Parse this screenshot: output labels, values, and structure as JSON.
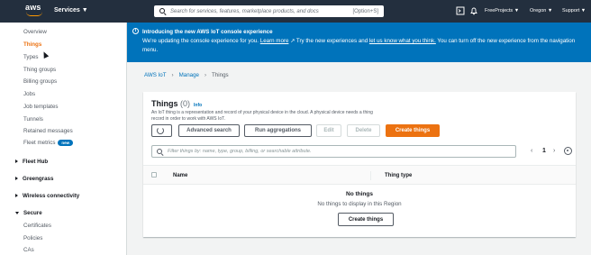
{
  "topnav": {
    "logo_text": "aws",
    "services_label": "Services ▼",
    "search_placeholder": "Search for services, features, marketplace products, and docs",
    "search_shortcut": "[Option+S]",
    "account": "FreeProjects ▼",
    "region": "Oregon ▼",
    "support": "Support ▼"
  },
  "sidebar": {
    "items": [
      {
        "label": "Overview"
      },
      {
        "label": "Things"
      },
      {
        "label": "Types"
      },
      {
        "label": "Thing groups"
      },
      {
        "label": "Billing groups"
      },
      {
        "label": "Jobs"
      },
      {
        "label": "Job templates"
      },
      {
        "label": "Tunnels"
      },
      {
        "label": "Retained messages"
      },
      {
        "label": "Fleet metrics",
        "badge": "new"
      }
    ],
    "sections": [
      {
        "label": "Fleet Hub"
      },
      {
        "label": "Greengrass"
      },
      {
        "label": "Wireless connectivity"
      },
      {
        "label": "Secure"
      }
    ],
    "secure_items": [
      {
        "label": "Certificates"
      },
      {
        "label": "Policies"
      },
      {
        "label": "CAs"
      }
    ]
  },
  "banner": {
    "title": "Introducing the new AWS IoT console experience",
    "body_1": "We're updating the console experience for you. ",
    "learn_more": "Learn more",
    "body_2": " Try the new experiences and ",
    "feedback_link": "let us know what you think.",
    "body_3": " You can turn off the new experience from the navigation menu."
  },
  "breadcrumb": [
    "AWS IoT",
    "Manage",
    "Things"
  ],
  "things": {
    "title": "Things",
    "count": "(0)",
    "info": "Info",
    "description": "An IoT thing is a representation and record of your physical device in the cloud. A physical device needs a thing record in order to work with AWS IoT.",
    "buttons": {
      "advanced_search": "Advanced search",
      "run_aggregations": "Run aggregations",
      "edit": "Edit",
      "delete": "Delete",
      "create": "Create things"
    },
    "filter_placeholder": "Filter things by: name, type, group, billing, or searchable attribute.",
    "pagination": {
      "prev": "‹",
      "page": "1",
      "next": "›"
    },
    "columns": [
      "Name",
      "Thing type"
    ],
    "empty_title": "No things",
    "empty_sub": "No things to display in this Region",
    "empty_button": "Create things"
  }
}
